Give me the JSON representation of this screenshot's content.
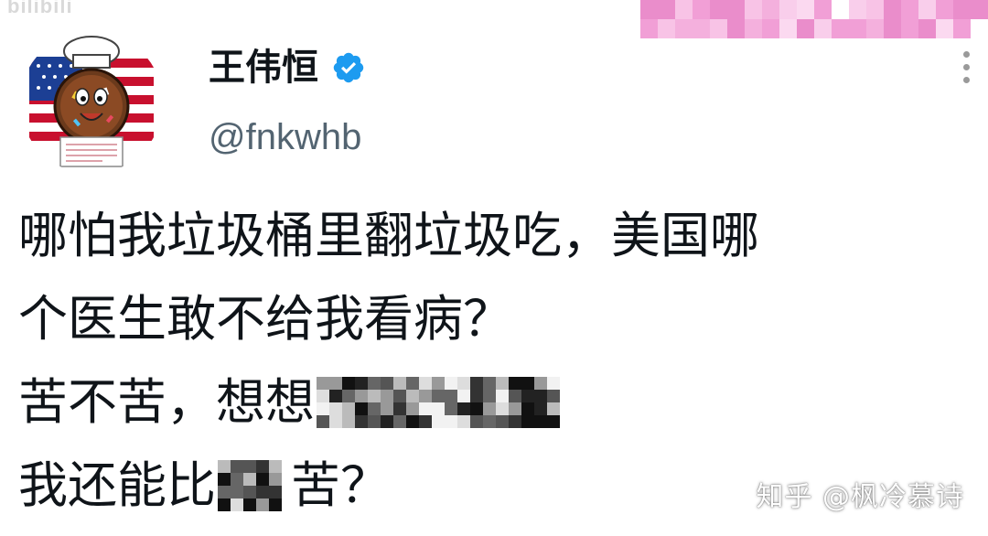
{
  "top_watermark": "bilibili",
  "profile": {
    "display_name": "王伟恒",
    "handle": "@fnkwhb",
    "verified": true,
    "verified_color": "#1d9bf0",
    "avatar": "cartoon-donut-with-us-flag"
  },
  "tweet": {
    "line1": "哪怕我垃圾桶里翻垃圾吃，美国哪",
    "line2": "个医生敢不给我看病？",
    "line3_prefix": "苦不苦，想想",
    "line3_censored": "pixelated",
    "line4_prefix": "我还能比",
    "line4_censored": "pixelated",
    "line4_suffix": "苦？"
  },
  "footer_watermark": "知乎 @枫冷慕诗",
  "colors": {
    "banner_pink": "#f2a6d8",
    "handle_gray": "#536471",
    "text": "#0f1419"
  }
}
